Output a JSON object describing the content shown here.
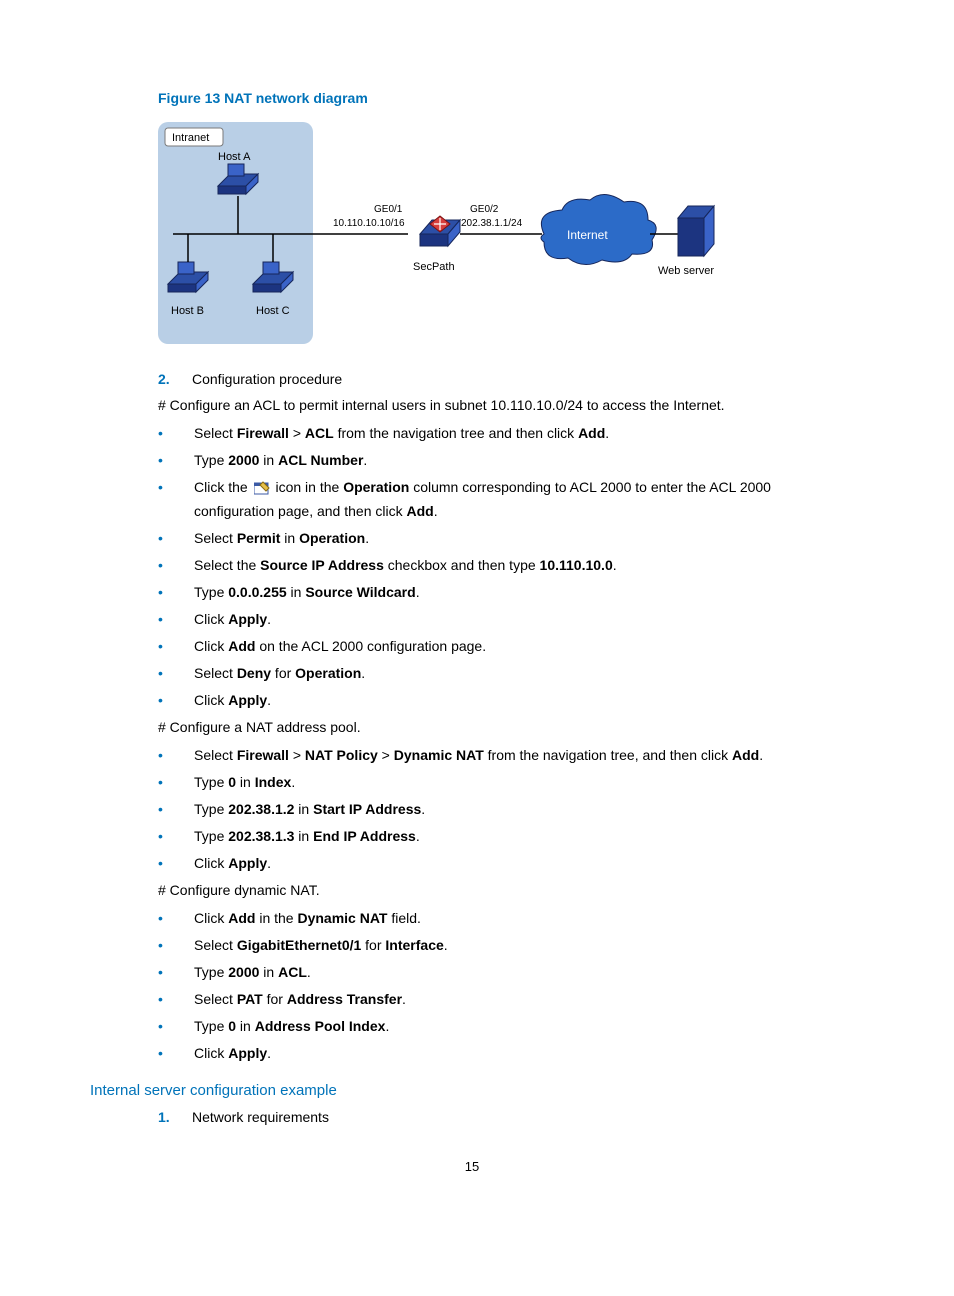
{
  "figure_caption": "Figure 13 NAT network diagram",
  "diagram": {
    "intranet": "Intranet",
    "hostA": "Host A",
    "hostB": "Host B",
    "hostC": "Host C",
    "ge01": "GE0/1",
    "ge01_ip": "10.110.10.10/16",
    "ge02": "GE0/2",
    "ge02_ip": "202.38.1.1/24",
    "secpath": "SecPath",
    "internet": "Internet",
    "webserver": "Web server"
  },
  "step2": {
    "num": "2.",
    "text": "Configuration procedure"
  },
  "hash1": "# Configure an ACL to permit internal users in subnet 10.110.10.0/24 to access the Internet.",
  "b1": {
    "p0": "Select ",
    "s1": "Firewall",
    "p1": " > ",
    "s2": "ACL",
    "p2": " from the navigation tree and then click ",
    "s3": "Add",
    "p3": "."
  },
  "b2": {
    "p0": "Type ",
    "s1": "2000",
    "p1": " in ",
    "s2": "ACL Number",
    "p2": "."
  },
  "b3": {
    "p0": "Click the ",
    "p1": " icon in the ",
    "s1": "Operation",
    "p2": " column corresponding to ACL 2000 to enter the ACL 2000 configuration page, and then click ",
    "s2": "Add",
    "p3": "."
  },
  "b4": {
    "p0": "Select ",
    "s1": "Permit",
    "p1": " in ",
    "s2": "Operation",
    "p2": "."
  },
  "b5": {
    "p0": "Select the ",
    "s1": "Source IP Address",
    "p1": " checkbox and then type ",
    "s2": "10.110.10.0",
    "p2": "."
  },
  "b6": {
    "p0": "Type ",
    "s1": "0.0.0.255",
    "p1": " in ",
    "s2": "Source Wildcard",
    "p2": "."
  },
  "b7": {
    "p0": "Click ",
    "s1": "Apply",
    "p1": "."
  },
  "b8": {
    "p0": "Click ",
    "s1": "Add",
    "p1": " on the ACL 2000 configuration page."
  },
  "b9": {
    "p0": "Select ",
    "s1": "Deny",
    "p1": " for ",
    "s2": "Operation",
    "p2": "."
  },
  "b10": {
    "p0": "Click ",
    "s1": "Apply",
    "p1": "."
  },
  "hash2": "# Configure a NAT address pool.",
  "c1": {
    "p0": "Select ",
    "s1": "Firewall",
    "p1": " > ",
    "s2": "NAT Policy",
    "p2": " > ",
    "s3": "Dynamic NAT",
    "p3": " from the navigation tree, and then click ",
    "s4": "Add",
    "p4": "."
  },
  "c2": {
    "p0": "Type ",
    "s1": "0",
    "p1": " in ",
    "s2": "Index",
    "p2": "."
  },
  "c3": {
    "p0": "Type ",
    "s1": "202.38.1.2",
    "p1": " in ",
    "s2": "Start IP Address",
    "p2": "."
  },
  "c4": {
    "p0": "Type ",
    "s1": "202.38.1.3",
    "p1": " in ",
    "s2": "End IP Address",
    "p2": "."
  },
  "c5": {
    "p0": "Click ",
    "s1": "Apply",
    "p1": "."
  },
  "hash3": "# Configure dynamic NAT.",
  "d1": {
    "p0": "Click ",
    "s1": "Add",
    "p1": " in the ",
    "s2": "Dynamic NAT",
    "p2": " field."
  },
  "d2": {
    "p0": "Select ",
    "s1": "GigabitEthernet0/1",
    "p1": " for ",
    "s2": "Interface",
    "p2": "."
  },
  "d3": {
    "p0": "Type ",
    "s1": "2000",
    "p1": " in ",
    "s2": "ACL",
    "p2": "."
  },
  "d4": {
    "p0": "Select ",
    "s1": "PAT",
    "p1": " for ",
    "s2": "Address Transfer",
    "p2": "."
  },
  "d5": {
    "p0": "Type ",
    "s1": "0",
    "p1": " in ",
    "s2": "Address Pool Index",
    "p2": "."
  },
  "d6": {
    "p0": "Click ",
    "s1": "Apply",
    "p1": "."
  },
  "section_heading": "Internal server configuration example",
  "step1b": {
    "num": "1.",
    "text": "Network requirements"
  },
  "page_number": "15"
}
